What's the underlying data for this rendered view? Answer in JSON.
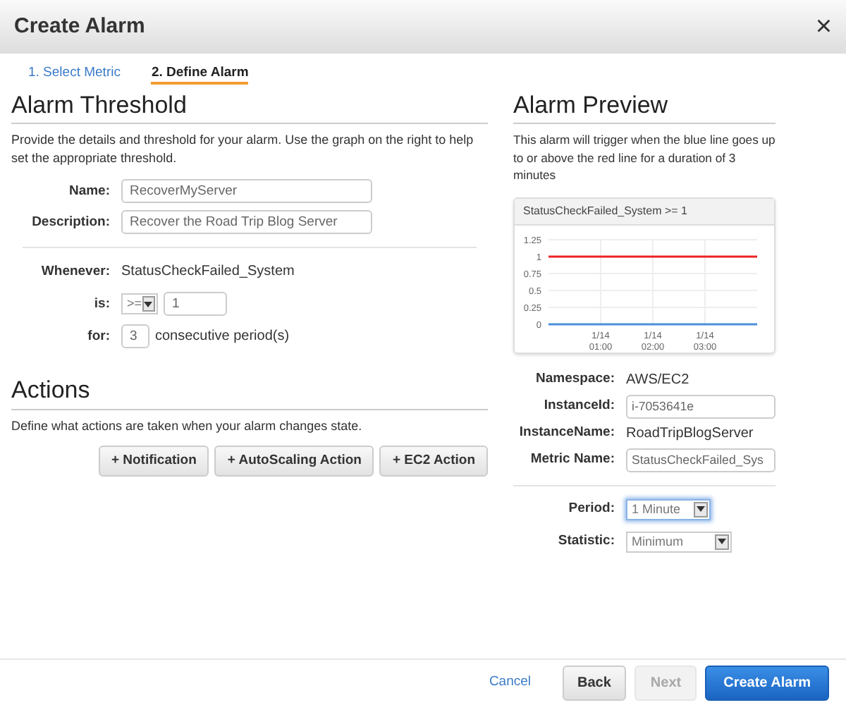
{
  "window": {
    "title": "Create Alarm",
    "close": "×"
  },
  "steps": [
    {
      "label": "1. Select Metric",
      "selected": false
    },
    {
      "label": "2. Define Alarm",
      "selected": true
    }
  ],
  "threshold": {
    "heading": "Alarm Threshold",
    "intro": "Provide the details and threshold for your alarm. Use the graph on the right to help set the appropriate threshold.",
    "fields": [
      {
        "kind": "text",
        "label": "Name:",
        "value": "RecoverMyServer"
      },
      {
        "kind": "text",
        "label": "Description:",
        "value": "Recover the Road Trip Blog Server"
      }
    ],
    "condition": [
      {
        "kind": "static",
        "label": "Whenever:",
        "value": "StatusCheckFailed_System"
      },
      {
        "kind": "compare",
        "label": "is:",
        "operator": ">=",
        "value": "1"
      },
      {
        "kind": "periods",
        "label": "for:",
        "value": "3",
        "suffix": "consecutive period(s)"
      }
    ]
  },
  "actions": {
    "heading": "Actions",
    "intro": "Define what actions are taken when your alarm changes state.",
    "buttons": [
      "+ Notification",
      "+ AutoScaling Action",
      "+ EC2 Action"
    ]
  },
  "preview": {
    "heading": "Alarm Preview",
    "intro": "This alarm will trigger when the blue line goes up to or above the red line for a duration of 3 minutes",
    "chart_data": {
      "type": "line",
      "grid": true,
      "title": "StatusCheckFailed_System >= 1",
      "categories": [
        null,
        "1/14 01:00",
        "1/14 02:00",
        "1/14 03:00",
        null
      ],
      "ylim": [
        0,
        1.25
      ],
      "yticks": [
        0,
        0.25,
        0.5,
        0.75,
        1,
        1.25
      ],
      "series": [
        {
          "color": "#ee2222",
          "values": [
            1,
            1,
            1,
            1,
            1
          ]
        },
        {
          "color": "#4a90d9",
          "values": [
            0,
            0,
            0,
            0,
            0
          ]
        }
      ]
    },
    "details": [
      {
        "kind": "static",
        "label": "Namespace:",
        "value": "AWS/EC2"
      },
      {
        "kind": "input",
        "label": "InstanceId:",
        "value": "i-7053641e"
      },
      {
        "kind": "static",
        "label": "InstanceName:",
        "value": "RoadTripBlogServer"
      },
      {
        "kind": "input",
        "label": "Metric Name:",
        "value": "StatusCheckFailed_Sys"
      }
    ],
    "settings": [
      {
        "label": "Period:",
        "value": "1 Minute",
        "focused": true
      },
      {
        "label": "Statistic:",
        "value": "Minimum",
        "focused": false
      }
    ]
  },
  "footer": [
    {
      "kind": "link",
      "label": "Cancel",
      "disabled": false
    },
    {
      "kind": "button",
      "label": "Back",
      "disabled": false
    },
    {
      "kind": "button",
      "label": "Next",
      "disabled": true
    },
    {
      "kind": "primary",
      "label": "Create Alarm",
      "disabled": false
    }
  ]
}
